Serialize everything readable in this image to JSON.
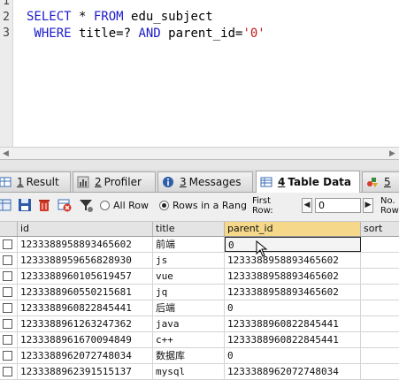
{
  "editor": {
    "line_numbers": [
      "1",
      "2",
      "3"
    ],
    "line1": {
      "kw1": "SELECT",
      "star": " * ",
      "kw2": "FROM",
      "table": " edu_subject"
    },
    "line2": {
      "kw1": " WHERE",
      "mid": " title=? ",
      "kw2": "AND",
      "rest": " parent_id=",
      "str": "'0'"
    }
  },
  "tabs": [
    {
      "num": "1",
      "label": "Result",
      "icon": "result-grid-icon"
    },
    {
      "num": "2",
      "label": "Profiler",
      "icon": "profiler-icon"
    },
    {
      "num": "3",
      "label": "Messages",
      "icon": "messages-info-icon"
    },
    {
      "num": "4",
      "label": "Table Data",
      "icon": "table-data-icon",
      "active": true
    },
    {
      "num": "5",
      "label": "",
      "icon": "info-shapes-icon"
    }
  ],
  "toolbar": {
    "all_row_label": "All Row",
    "rows_range_label": "Rows in a Rang",
    "first_row_label": "First Row:",
    "first_row_value": "0",
    "no_of_rows_label": "No. Row"
  },
  "grid": {
    "columns": [
      "id",
      "title",
      "parent_id",
      "sort"
    ],
    "selected_column": "parent_id",
    "rows": [
      {
        "id": "1233388958893465602",
        "title": "前端",
        "parent_id": "0",
        "sort": ""
      },
      {
        "id": "1233388959656828930",
        "title": "js",
        "parent_id": "1233388958893465602",
        "sort": ""
      },
      {
        "id": "1233388960105619457",
        "title": "vue",
        "parent_id": "1233388958893465602",
        "sort": ""
      },
      {
        "id": "1233388960550215681",
        "title": "jq",
        "parent_id": "1233388958893465602",
        "sort": ""
      },
      {
        "id": "1233388960822845441",
        "title": "后端",
        "parent_id": "0",
        "sort": ""
      },
      {
        "id": "1233388961263247362",
        "title": "java",
        "parent_id": "1233388960822845441",
        "sort": ""
      },
      {
        "id": "1233388961670094849",
        "title": "c++",
        "parent_id": "1233388960822845441",
        "sort": ""
      },
      {
        "id": "1233388962072748034",
        "title": "数据库",
        "parent_id": "0",
        "sort": ""
      },
      {
        "id": "1233388962391515137",
        "title": "mysql",
        "parent_id": "1233388962072748034",
        "sort": ""
      }
    ]
  },
  "colors": {
    "keyword": "#1c1cc8",
    "string": "#c01818",
    "selected_header": "#f5d88a"
  }
}
